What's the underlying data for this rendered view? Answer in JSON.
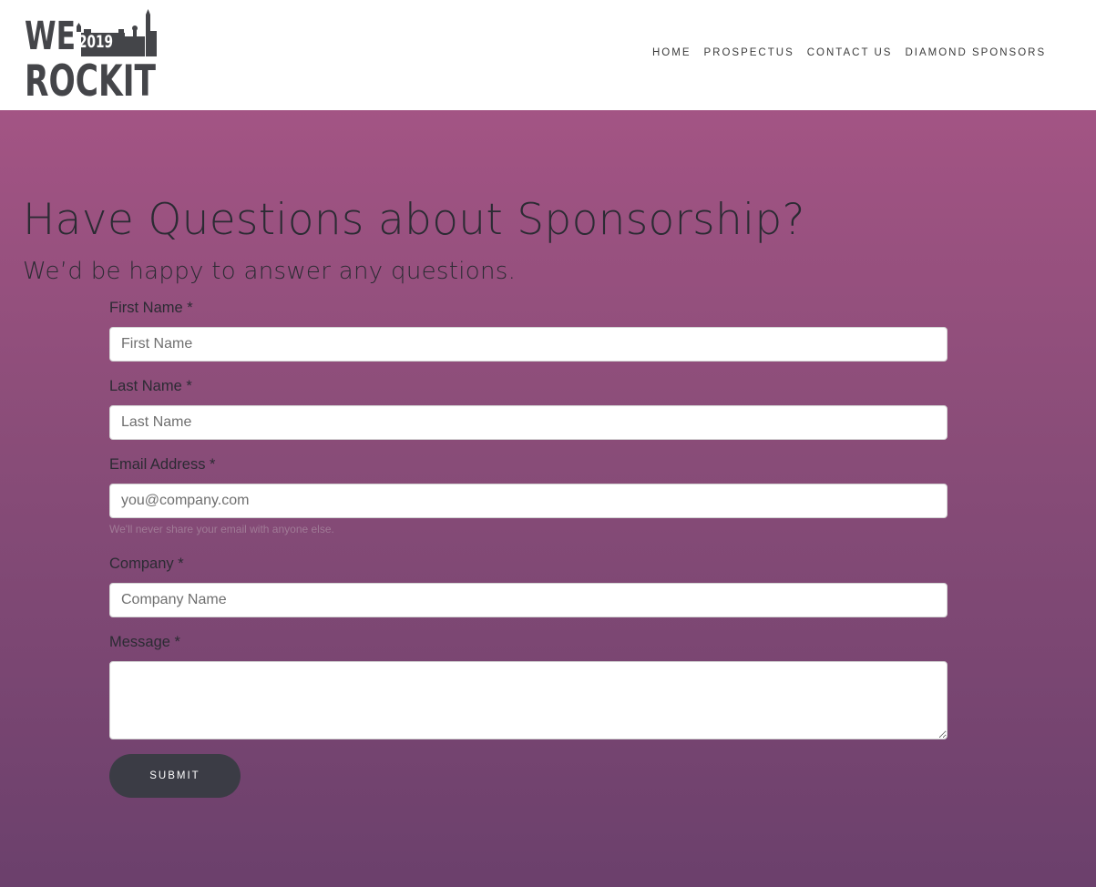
{
  "logo": {
    "line1": "WE",
    "year": "2019",
    "line2": "ROCKIT",
    "color": "#444549"
  },
  "nav": {
    "items": [
      {
        "label": "HOME"
      },
      {
        "label": "PROSPECTUS"
      },
      {
        "label": "CONTACT US"
      },
      {
        "label": "DIAMOND SPONSORS"
      }
    ]
  },
  "hero": {
    "title": "Have Questions about Sponsorship?",
    "subtitle": "We’d be happy to answer any questions.",
    "gradient_top": "#a35484",
    "gradient_bottom": "#6b406c"
  },
  "form": {
    "first_name": {
      "label": "First Name *",
      "placeholder": "First Name",
      "value": ""
    },
    "last_name": {
      "label": "Last Name *",
      "placeholder": "Last Name",
      "value": ""
    },
    "email": {
      "label": "Email Address *",
      "placeholder": "you@company.com",
      "value": "",
      "help": "We'll never share your email with anyone else."
    },
    "company": {
      "label": "Company *",
      "placeholder": "Company Name",
      "value": ""
    },
    "message": {
      "label": "Message *",
      "value": ""
    },
    "submit_label": "SUBMIT",
    "submit_color": "#3b3c45"
  }
}
